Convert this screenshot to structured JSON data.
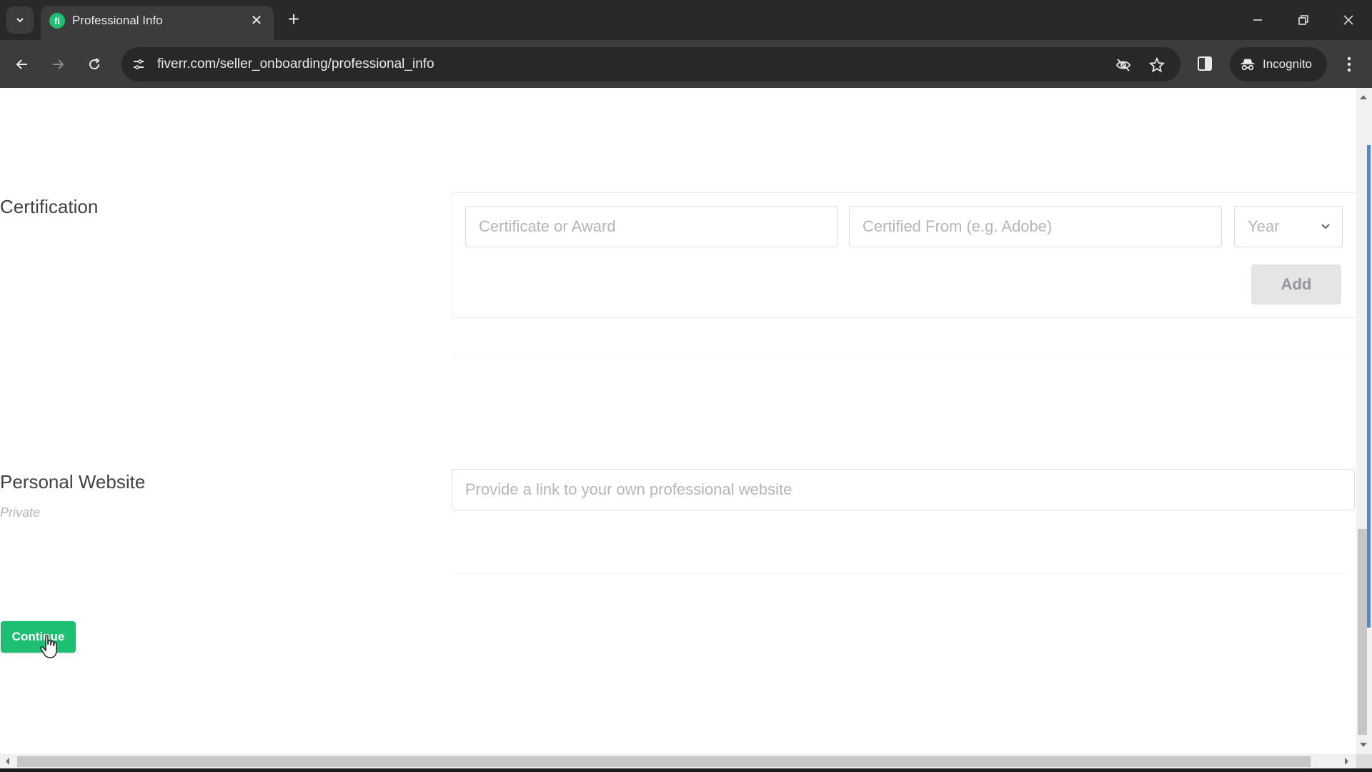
{
  "browser": {
    "tab_title": "Professional Info",
    "favicon_letter": "fi",
    "url": "fiverr.com/seller_onboarding/professional_info",
    "incognito_label": "Incognito",
    "icons": {
      "tab_search": "chevron-down-icon",
      "tab_close": "close-icon",
      "new_tab": "plus-icon",
      "back": "arrow-left-icon",
      "forward": "arrow-right-icon",
      "reload": "reload-icon",
      "site_info": "tune-icon",
      "tracking": "eye-off-icon",
      "bookmark": "star-icon",
      "side_panel": "side-panel-icon",
      "incognito": "incognito-icon",
      "menu": "more-vertical-icon"
    },
    "tab_close_glyph": "✕",
    "new_tab_glyph": "+"
  },
  "form": {
    "certification": {
      "label": "Certification",
      "certificate_placeholder": "Certificate or Award",
      "certified_from_placeholder": "Certified From (e.g. Adobe)",
      "year_select": {
        "selected": "Year"
      },
      "add_button": "Add"
    },
    "personal_website": {
      "label": "Personal Website",
      "sublabel": "Private",
      "placeholder": "Provide a link to your own professional website"
    },
    "continue_button": "Continue"
  },
  "colors": {
    "brand_green": "#1dbf73",
    "scroll_accent": "#4a88d8"
  }
}
